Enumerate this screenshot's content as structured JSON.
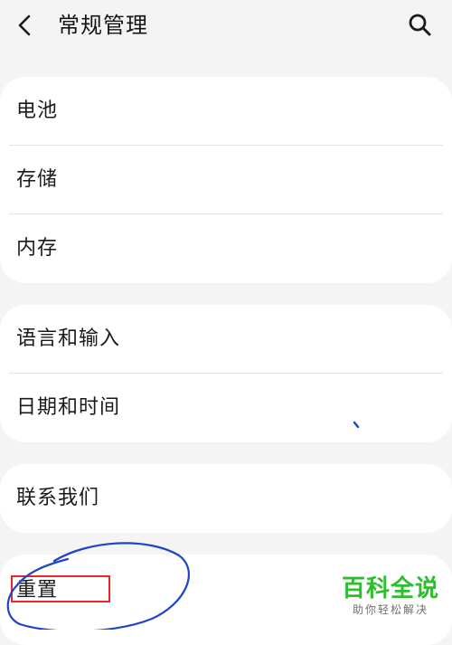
{
  "header": {
    "title": "常规管理",
    "back_icon": "chevron-left-icon",
    "search_icon": "search-icon"
  },
  "group1": {
    "items": [
      {
        "label": "电池"
      },
      {
        "label": "存储"
      },
      {
        "label": "内存"
      }
    ]
  },
  "group2": {
    "items": [
      {
        "label": "语言和输入"
      },
      {
        "label": "日期和时间"
      }
    ]
  },
  "group3": {
    "items": [
      {
        "label": "联系我们"
      }
    ]
  },
  "group4": {
    "items": [
      {
        "label": "重置"
      }
    ]
  },
  "annotation": {
    "highlight_color": "#e8262b",
    "scribble_color": "#1f44c9"
  },
  "watermark": {
    "title": "百科全说",
    "subtitle": "助你轻松解决",
    "color": "#2ebd2e"
  }
}
